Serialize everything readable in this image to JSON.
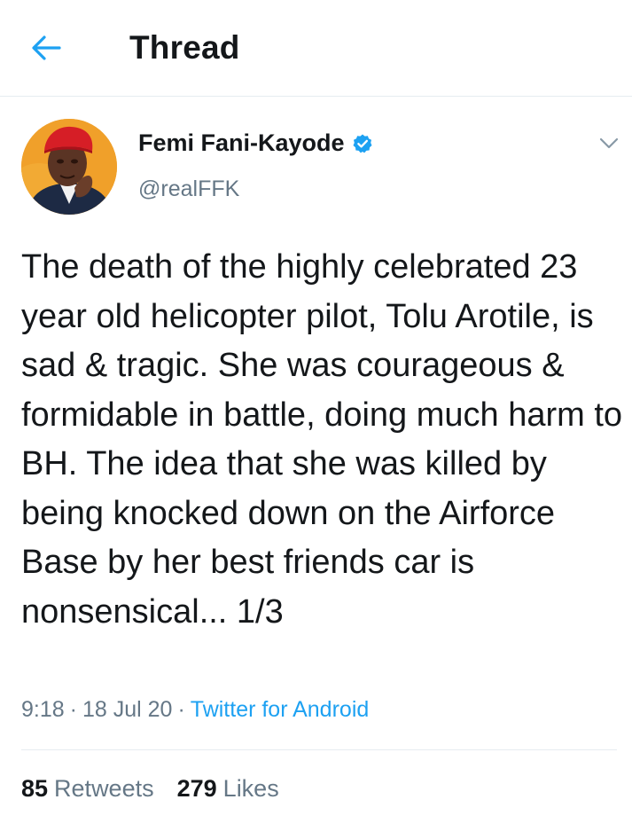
{
  "header": {
    "back_icon": "arrow-left-icon",
    "title": "Thread"
  },
  "author": {
    "name": "Femi Fani-Kayode",
    "handle": "@realFFK",
    "verified_icon": "verified-badge-icon",
    "avatar_icon": "avatar-photo"
  },
  "tweet": {
    "text": "The death of the highly celebrated 23 year old helicopter pilot, Tolu Arotile, is sad & tragic. She was courageous & formidable in battle, doing much harm to BH. The idea that she was killed by being knocked down on the Airforce Base by her best friends car is nonsensical... 1/3",
    "time": "9:18",
    "date": "18 Jul 20",
    "source": "Twitter for Android",
    "separator": "·",
    "menu_icon": "chevron-down-icon"
  },
  "stats": {
    "retweets_count": "85",
    "retweets_label": "Retweets",
    "likes_count": "279",
    "likes_label": "Likes"
  },
  "colors": {
    "accent": "#1da1f2",
    "text_primary": "#14171a",
    "text_secondary": "#657786",
    "divider": "#e6ecf0"
  }
}
